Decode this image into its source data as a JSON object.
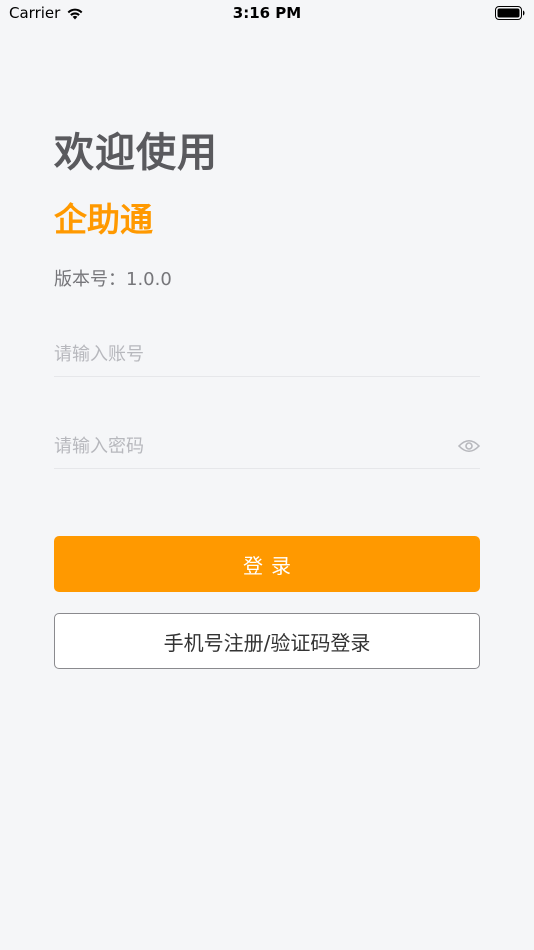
{
  "status_bar": {
    "carrier": "Carrier",
    "time": "3:16 PM"
  },
  "header": {
    "welcome": "欢迎使用",
    "brand": "企助通",
    "version": "版本号：1.0.0"
  },
  "form": {
    "account_placeholder": "请输入账号",
    "account_value": "",
    "password_placeholder": "请输入密码",
    "password_value": ""
  },
  "buttons": {
    "login_label": "登录",
    "register_label": "手机号注册/验证码登录"
  },
  "colors": {
    "accent": "#ff9900",
    "background": "#f5f6f8",
    "heading": "#5a5a5e",
    "placeholder": "#b7b8bd"
  },
  "icons": {
    "wifi": "wifi-icon",
    "battery": "battery-icon",
    "eye": "eye-icon"
  }
}
